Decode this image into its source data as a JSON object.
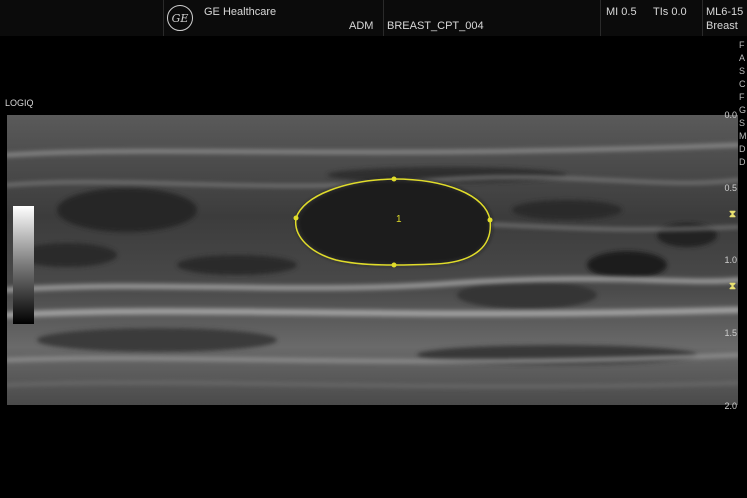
{
  "header": {
    "brand": "GE Healthcare",
    "operator": "ADM",
    "study_id": "BREAST_CPT_004",
    "mi": "MI 0.5",
    "tis": "TIs 0.0",
    "probe": "ML6-15",
    "preset": "Breast",
    "logo_icon": "ge-logo-icon"
  },
  "image": {
    "system_label": "LOGIQ",
    "lesion_label": "1",
    "trace_color": "#e0dc2a",
    "depth_ticks": [
      "0.0",
      "0.5",
      "1.0",
      "1.5",
      "2.0"
    ],
    "focus_marker_icon": "focus-marker-icon",
    "focus_marker_glyph": "⧗"
  },
  "side_menu_letters": [
    "F",
    "A",
    "S",
    "C",
    "F",
    "G",
    "S",
    "M",
    "D",
    "D"
  ]
}
